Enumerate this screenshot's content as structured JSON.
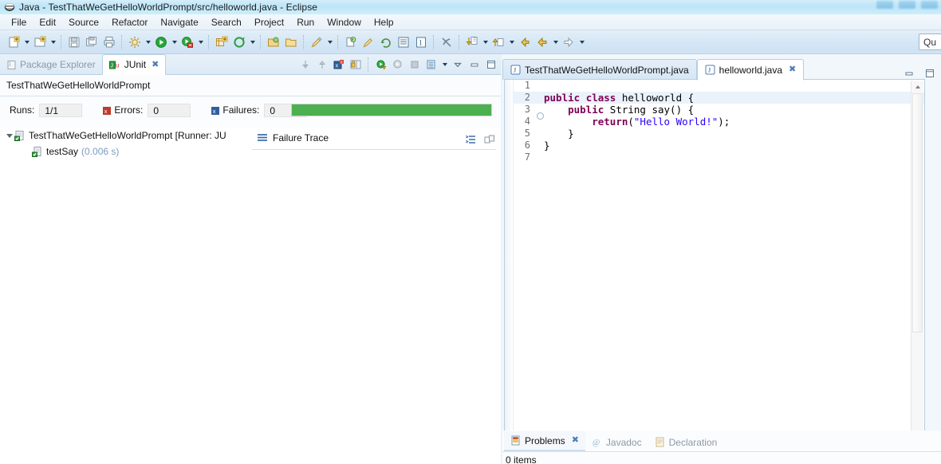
{
  "window": {
    "title": "Java - TestThatWeGetHelloWorldPrompt/src/helloworld.java - Eclipse",
    "app_icon": "eclipse-icon"
  },
  "menubar": {
    "items": [
      {
        "label": "File",
        "name": "menu-file"
      },
      {
        "label": "Edit",
        "name": "menu-edit"
      },
      {
        "label": "Source",
        "name": "menu-source"
      },
      {
        "label": "Refactor",
        "name": "menu-refactor"
      },
      {
        "label": "Navigate",
        "name": "menu-navigate"
      },
      {
        "label": "Search",
        "name": "menu-search"
      },
      {
        "label": "Project",
        "name": "menu-project"
      },
      {
        "label": "Run",
        "name": "menu-run"
      },
      {
        "label": "Window",
        "name": "menu-window"
      },
      {
        "label": "Help",
        "name": "menu-help"
      }
    ]
  },
  "toolbar": {
    "quick_access_value": "Qu",
    "quick_access_placeholder": "Quick Access"
  },
  "junit_view": {
    "tabs": [
      {
        "label": "Package Explorer",
        "active": false,
        "icon": "package-explorer-icon"
      },
      {
        "label": "JUnit",
        "active": true,
        "icon": "junit-icon",
        "closable": true
      }
    ],
    "title": "TestThatWeGetHelloWorldPrompt",
    "counters": {
      "runs_label": "Runs:",
      "runs_value": "1/1",
      "errors_label": "Errors:",
      "errors_value": "0",
      "failures_label": "Failures:",
      "failures_value": "0"
    },
    "progress": {
      "percent": 100,
      "color": "#4cb050"
    },
    "tree": [
      {
        "label": "TestThatWeGetHelloWorldPrompt [Runner: JU",
        "time": "",
        "expanded": true,
        "depth": 0,
        "icon": "test-suite-icon"
      },
      {
        "label": "testSay",
        "time": "(0.006 s)",
        "expanded": false,
        "depth": 1,
        "icon": "test-case-icon"
      }
    ],
    "failure_trace": {
      "title": "Failure Trace",
      "icon": "failure-trace-icon"
    }
  },
  "editor": {
    "tabs": [
      {
        "label": "TestThatWeGetHelloWorldPrompt.java",
        "active": false,
        "closable": false,
        "icon": "java-file-icon"
      },
      {
        "label": "helloworld.java",
        "active": true,
        "closable": true,
        "icon": "java-file-icon"
      }
    ],
    "lines": [
      {
        "num": "1",
        "highlight": false,
        "fold": false,
        "tokens": []
      },
      {
        "num": "2",
        "highlight": true,
        "fold": false,
        "tokens": [
          {
            "t": "public",
            "c": "kw"
          },
          {
            "t": " ",
            "c": ""
          },
          {
            "t": "class",
            "c": "kw"
          },
          {
            "t": " helloworld {",
            "c": ""
          }
        ]
      },
      {
        "num": "3",
        "highlight": false,
        "fold": true,
        "tokens": [
          {
            "t": "    ",
            "c": ""
          },
          {
            "t": "public",
            "c": "kw"
          },
          {
            "t": " String say() {",
            "c": ""
          }
        ]
      },
      {
        "num": "4",
        "highlight": false,
        "fold": false,
        "tokens": [
          {
            "t": "        ",
            "c": ""
          },
          {
            "t": "return",
            "c": "kw"
          },
          {
            "t": "(",
            "c": ""
          },
          {
            "t": "\"Hello World!\"",
            "c": "str"
          },
          {
            "t": ");",
            "c": ""
          }
        ]
      },
      {
        "num": "5",
        "highlight": false,
        "fold": false,
        "tokens": [
          {
            "t": "    }",
            "c": ""
          }
        ]
      },
      {
        "num": "6",
        "highlight": false,
        "fold": false,
        "tokens": [
          {
            "t": "}",
            "c": ""
          }
        ]
      },
      {
        "num": "7",
        "highlight": false,
        "fold": false,
        "tokens": []
      }
    ]
  },
  "bottom_view": {
    "tabs": [
      {
        "label": "Problems",
        "active": true,
        "closable": true,
        "icon": "problems-icon"
      },
      {
        "label": "Javadoc",
        "active": false,
        "closable": false,
        "icon": "javadoc-icon"
      },
      {
        "label": "Declaration",
        "active": false,
        "closable": false,
        "icon": "declaration-icon"
      }
    ],
    "items_label": "0 items"
  },
  "colors": {
    "accent": "#4cb050",
    "keyword": "#7f0055",
    "string": "#2a00ff",
    "title_bar": "#bde4f7"
  }
}
